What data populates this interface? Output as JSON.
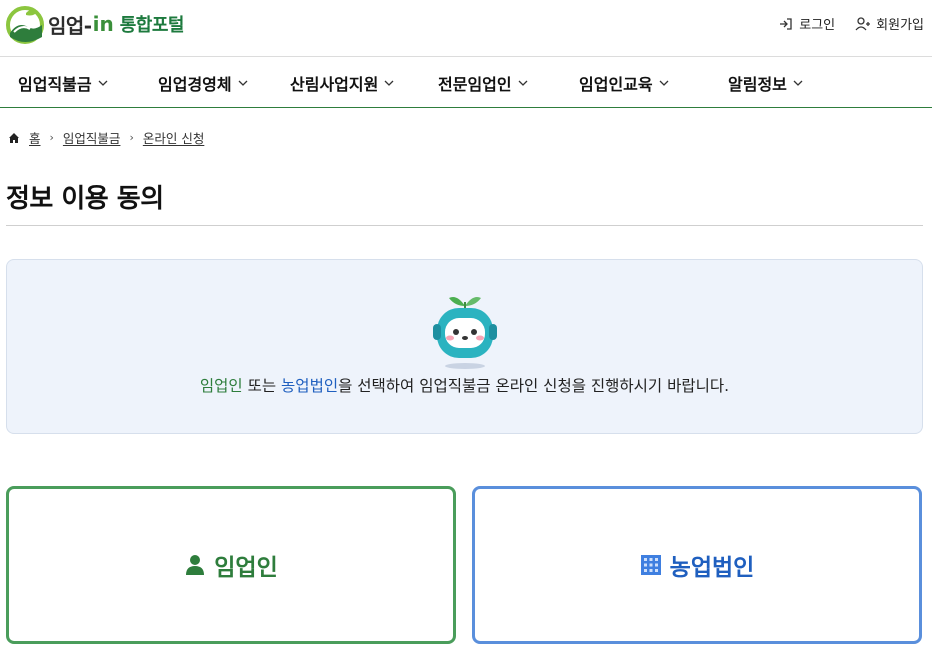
{
  "header": {
    "logo": {
      "name": "임업-",
      "in": "in",
      "portal": "통합포털"
    },
    "util": {
      "login": "로그인",
      "signup": "회원가입"
    }
  },
  "gnb": [
    {
      "label": "임업직불금"
    },
    {
      "label": "임업경영체"
    },
    {
      "label": "산림사업지원"
    },
    {
      "label": "전문임업인"
    },
    {
      "label": "임업인교육"
    },
    {
      "label": "알림정보"
    }
  ],
  "breadcrumb": {
    "home": "홈",
    "level1": "임업직불금",
    "level2": "온라인 신청",
    "sep": "›"
  },
  "page": {
    "title": "정보 이용 동의"
  },
  "info": {
    "part1": "임업인",
    "part2": " 또는 ",
    "part3": "농업법인",
    "part4": "을 선택하여 임업직불금 온라인 신청을 진행하시기 바랍니다."
  },
  "choices": {
    "personal": "임업인",
    "corporation": "농업법인"
  },
  "colors": {
    "green": "#2e7d3c",
    "blue": "#1f5fbf",
    "info_bg": "#eef3fb"
  }
}
